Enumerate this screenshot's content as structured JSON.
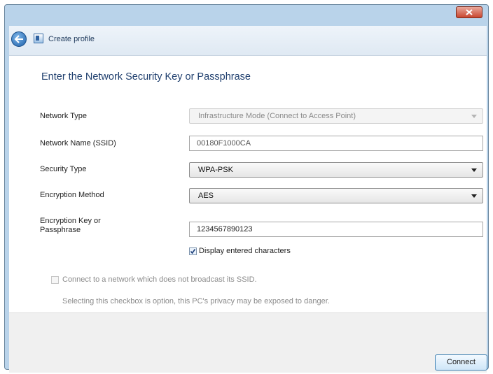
{
  "window": {
    "title": "Create profile"
  },
  "heading": "Enter the Network Security Key or Passphrase",
  "form": {
    "network_type": {
      "label": "Network Type",
      "value": "Infrastructure Mode (Connect to Access Point)"
    },
    "network_name": {
      "label": "Network Name (SSID)",
      "value": "00180F1000CA"
    },
    "security_type": {
      "label": "Security Type",
      "value": "WPA-PSK"
    },
    "encryption_method": {
      "label": "Encryption Method",
      "value": "AES"
    },
    "encryption_key": {
      "label_line1": "Encryption Key or",
      "label_line2": "Passphrase",
      "value": "1234567890123"
    }
  },
  "display_chars": {
    "label": "Display entered characters",
    "checked": true
  },
  "hidden_ssid": {
    "label": "Connect to a network which does not broadcast its SSID.",
    "note": "Selecting this checkbox is option, this PC's privacy may be exposed to danger.",
    "checked": false
  },
  "buttons": {
    "connect": "Connect"
  }
}
